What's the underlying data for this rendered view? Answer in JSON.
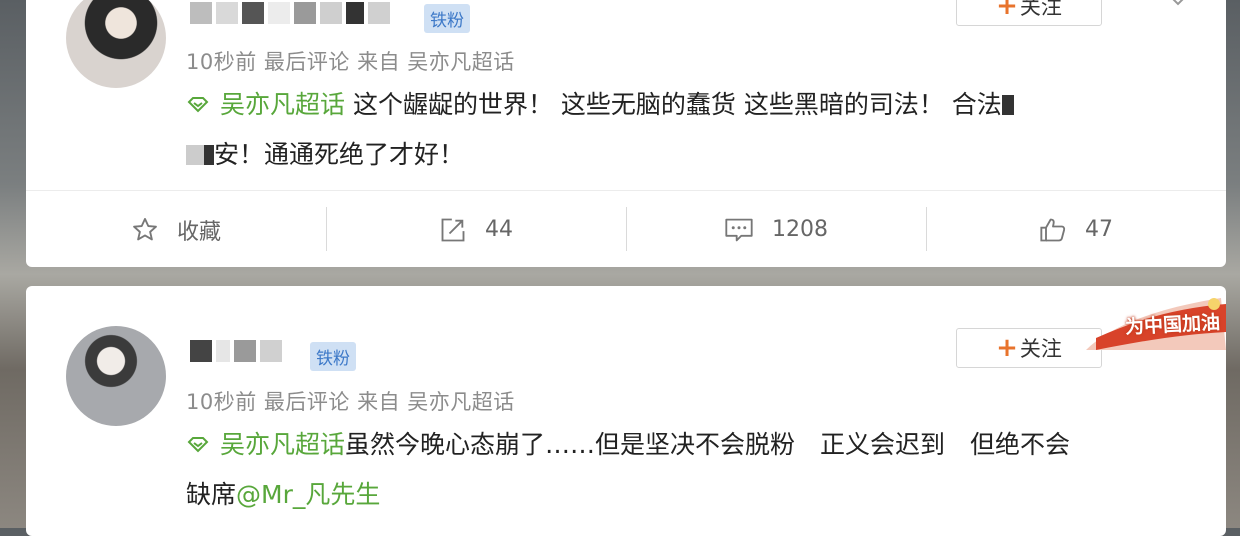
{
  "posts": [
    {
      "badge": "铁粉",
      "meta": "10秒前 最后评论 来自 吴亦凡超话",
      "follow_label": "关注",
      "topic": "吴亦凡超话",
      "text_line1": " 这个龌龊的世界！ 这些无脑的蠢货 这些黑暗的司法！ 合法",
      "text_line2": "安！通通死绝了才好！",
      "actions": {
        "favorite_label": "收藏",
        "repost_count": "44",
        "comment_count": "1208",
        "like_count": "47"
      }
    },
    {
      "badge": "铁粉",
      "meta": "10秒前 最后评论 来自 吴亦凡超话",
      "follow_label": "关注",
      "topic": "吴亦凡超话",
      "text_line1": "虽然今晚心态崩了……但是坚决不会脱粉　正义会迟到　但绝不会",
      "text_line2_prefix": "缺席",
      "mention": "@Mr_凡先生",
      "sticker": "为中国加油"
    }
  ],
  "colors": {
    "topic_green": "#58a73b",
    "follow_plus": "#e8732c",
    "badge_bg": "#cfe0f4",
    "badge_text": "#3d79c8"
  },
  "icons": [
    "topic-icon",
    "star-icon",
    "share-icon",
    "comment-icon",
    "thumbs-up-icon",
    "chevron-down-icon"
  ]
}
